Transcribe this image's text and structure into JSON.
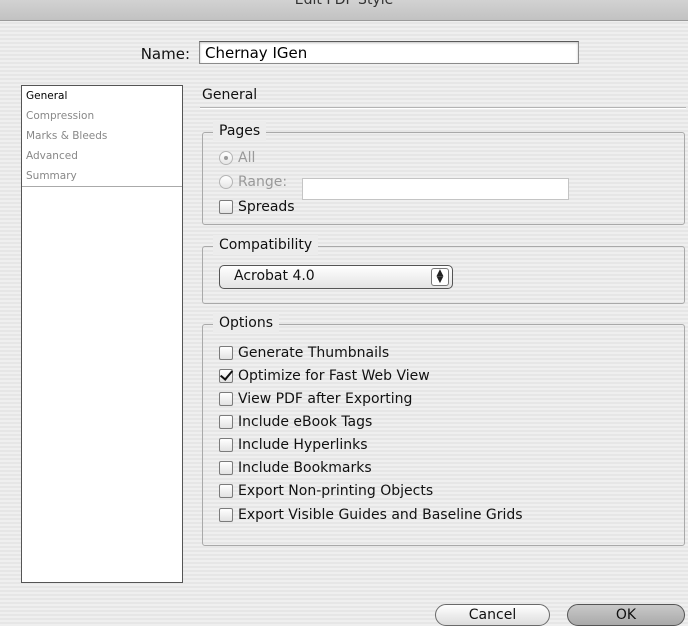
{
  "window": {
    "title": "Edit PDF Style"
  },
  "name_field": {
    "label": "Name:",
    "value": "Chernay IGen"
  },
  "sidebar": {
    "items": [
      {
        "label": "General"
      },
      {
        "label": "Compression"
      },
      {
        "label": "Marks & Bleeds"
      },
      {
        "label": "Advanced"
      },
      {
        "label": "Summary"
      }
    ]
  },
  "section_title": "General",
  "pages": {
    "title": "Pages",
    "all_label": "All",
    "range_label": "Range:",
    "range_value": "",
    "spreads_label": "Spreads"
  },
  "compatibility": {
    "title": "Compatibility",
    "selected": "Acrobat 4.0"
  },
  "options": {
    "title": "Options",
    "items": [
      {
        "label": "Generate Thumbnails",
        "checked": false
      },
      {
        "label": "Optimize for Fast Web View",
        "checked": true
      },
      {
        "label": "View PDF after Exporting",
        "checked": false
      },
      {
        "label": "Include eBook Tags",
        "checked": false
      },
      {
        "label": "Include Hyperlinks",
        "checked": false
      },
      {
        "label": "Include Bookmarks",
        "checked": false
      },
      {
        "label": "Export Non-printing Objects",
        "checked": false
      },
      {
        "label": "Export Visible Guides and Baseline Grids",
        "checked": false
      }
    ]
  },
  "buttons": {
    "cancel": "Cancel",
    "ok": "OK"
  }
}
